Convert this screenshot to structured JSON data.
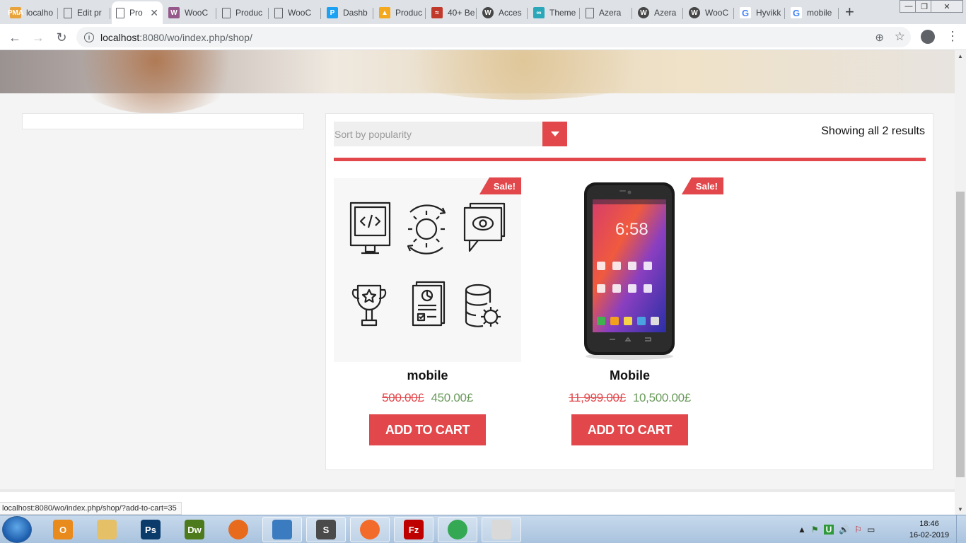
{
  "browser": {
    "tabs": [
      {
        "label": "localho",
        "icon": "phpmyadmin-icon",
        "icon_text": "PMA",
        "icon_color": "#e8a33c"
      },
      {
        "label": "Edit pr",
        "icon": "page-icon",
        "icon_text": "",
        "icon_color": "#ffffff"
      },
      {
        "label": "Pro",
        "icon": "page-icon",
        "icon_text": "",
        "icon_color": "#ffffff",
        "active": true
      },
      {
        "label": "WooC",
        "icon": "woo-icon",
        "icon_text": "W",
        "icon_color": "#96588a"
      },
      {
        "label": "Produc",
        "icon": "page-icon",
        "icon_text": "",
        "icon_color": "#ffffff"
      },
      {
        "label": "WooC",
        "icon": "page-icon",
        "icon_text": "",
        "icon_color": "#ffffff"
      },
      {
        "label": "Dashb",
        "icon": "dashboard-icon",
        "icon_text": "P",
        "icon_color": "#1da1f2"
      },
      {
        "label": "Produc",
        "icon": "graduation-icon",
        "icon_text": "▲",
        "icon_color": "#f4a81d"
      },
      {
        "label": "40+ Be",
        "icon": "brand-icon",
        "icon_text": "≈",
        "icon_color": "#c0392b"
      },
      {
        "label": "Acces",
        "icon": "wordpress-icon",
        "icon_text": "W",
        "icon_color": "#464646"
      },
      {
        "label": "Theme",
        "icon": "theme-icon",
        "icon_text": "∞",
        "icon_color": "#2aa7b9"
      },
      {
        "label": "Azera",
        "icon": "page-icon",
        "icon_text": "",
        "icon_color": "#ffffff"
      },
      {
        "label": "Azera",
        "icon": "wordpress-icon",
        "icon_text": "W",
        "icon_color": "#464646"
      },
      {
        "label": "WooC",
        "icon": "wordpress-icon",
        "icon_text": "W",
        "icon_color": "#464646"
      },
      {
        "label": "Hyvikk",
        "icon": "google-icon",
        "icon_text": "G",
        "icon_color": "#4285f4"
      },
      {
        "label": "mobile",
        "icon": "google-icon",
        "icon_text": "G",
        "icon_color": "#4285f4"
      }
    ],
    "url_host": "localhost",
    "url_rest": ":8080/wo/index.php/shop/"
  },
  "page": {
    "sort": {
      "label": "Sort by popularity"
    },
    "result_count": "Showing all 2 results",
    "products": [
      {
        "title": "mobile",
        "sale_badge": "Sale!",
        "price_old": "500.00£",
        "price_new": "450.00£",
        "button": "ADD TO CART",
        "image": "icons-grid"
      },
      {
        "title": "Mobile",
        "sale_badge": "Sale!",
        "price_old": "11,999.00£",
        "price_new": "10,500.00£",
        "button": "ADD TO CART",
        "image": "smartphone"
      }
    ],
    "status_url": "localhost:8080/wo/index.php/shop/?add-to-cart=35"
  },
  "taskbar": {
    "apps": [
      {
        "name": "outlook",
        "icon": "outlook-icon",
        "label": "O",
        "color": "#e98a1c"
      },
      {
        "name": "explorer",
        "icon": "folder-icon",
        "label": "",
        "color": "#e6c067"
      },
      {
        "name": "photoshop",
        "icon": "photoshop-icon",
        "label": "Ps",
        "color": "#0a3b6b"
      },
      {
        "name": "dreamweaver",
        "icon": "dreamweaver-icon",
        "label": "Dw",
        "color": "#4d7a1a"
      },
      {
        "name": "firefox",
        "icon": "firefox-icon",
        "label": "",
        "color": "#e86a1c"
      },
      {
        "name": "messenger",
        "icon": "messenger-icon",
        "label": "",
        "color": "#3b7bc0"
      },
      {
        "name": "sublime",
        "icon": "sublime-icon",
        "label": "S",
        "color": "#4a4a4a"
      },
      {
        "name": "postman",
        "icon": "postman-icon",
        "label": "",
        "color": "#f26b2a"
      },
      {
        "name": "filezilla",
        "icon": "filezilla-icon",
        "label": "Fz",
        "color": "#bf0000"
      },
      {
        "name": "chrome",
        "icon": "chrome-icon",
        "label": "",
        "color": "#34a853"
      },
      {
        "name": "paint",
        "icon": "paint-icon",
        "label": "",
        "color": "#d9d9d9"
      }
    ],
    "clock_time": "18:46",
    "clock_date": "16-02-2019"
  },
  "colors": {
    "accent": "#e2474b",
    "price_new": "#6a9a5c"
  }
}
